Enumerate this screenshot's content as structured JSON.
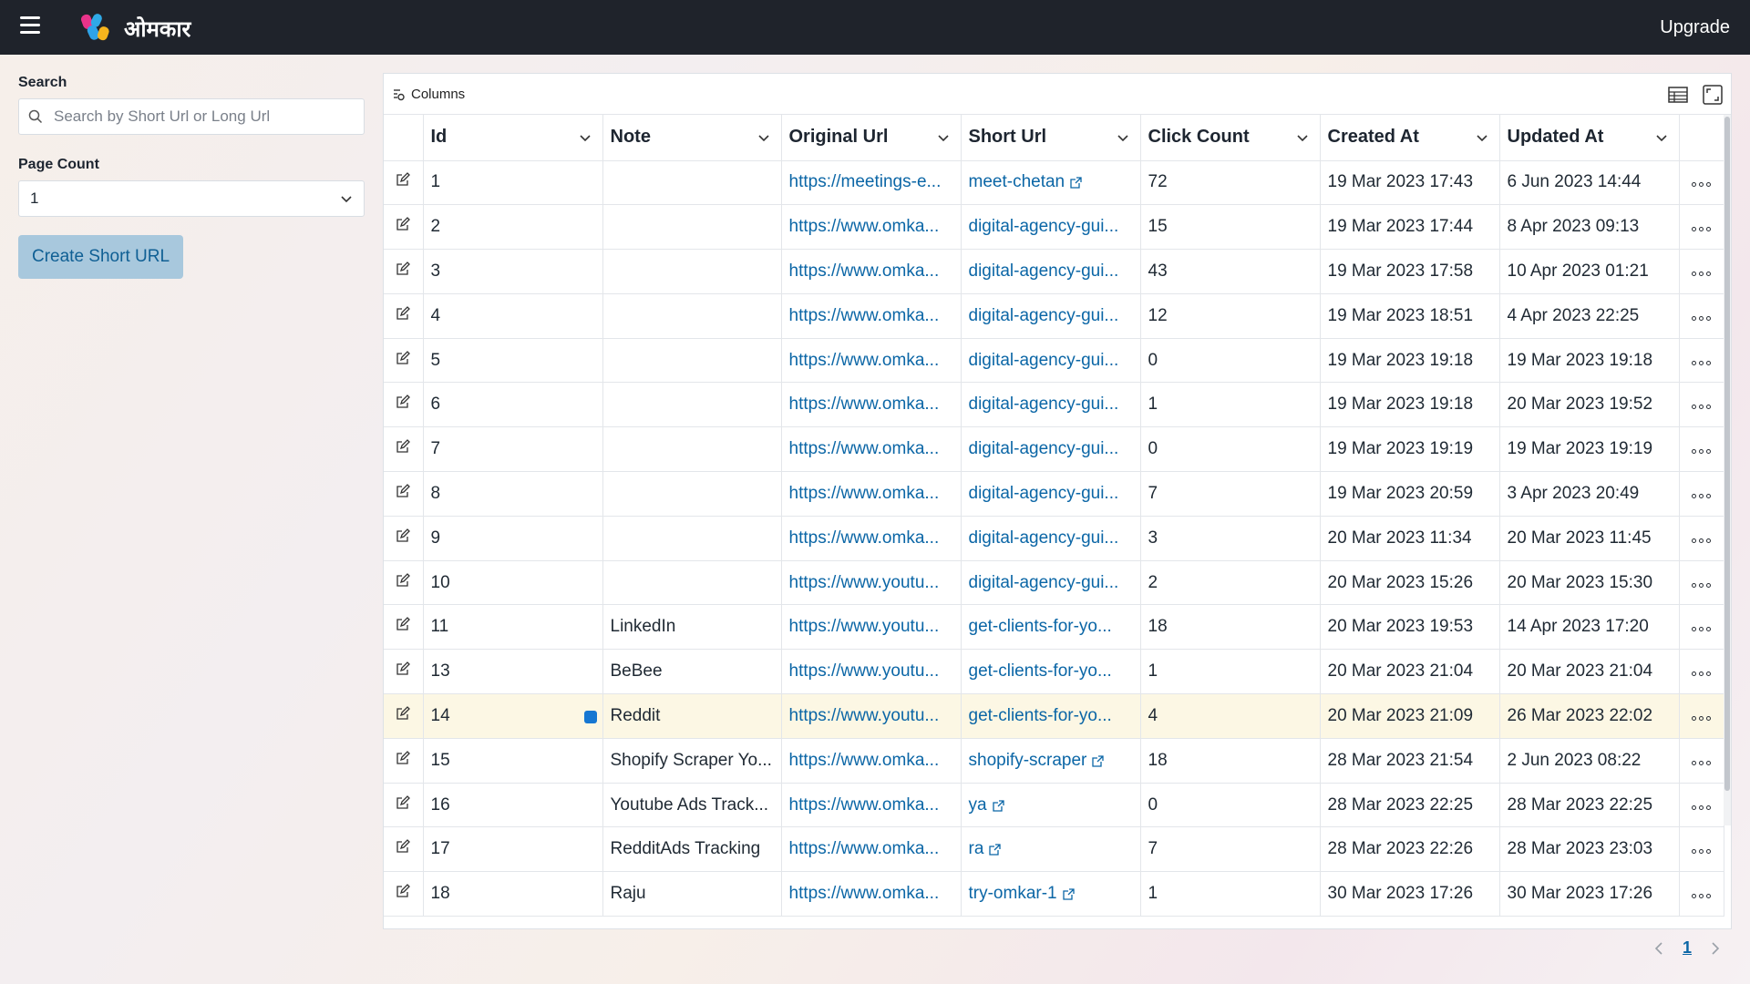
{
  "header": {
    "brand": "ओमकार",
    "upgrade_label": "Upgrade"
  },
  "sidebar": {
    "search_label": "Search",
    "search_placeholder": "Search by Short Url or Long Url",
    "page_count_label": "Page Count",
    "page_count_value": "1",
    "create_button": "Create Short URL"
  },
  "toolbar": {
    "columns_label": "Columns"
  },
  "table": {
    "headers": [
      "Id",
      "Note",
      "Original Url",
      "Short Url",
      "Click Count",
      "Created At",
      "Updated At"
    ],
    "rows": [
      {
        "id": "1",
        "note": "",
        "original": "https://meetings-e...",
        "short": "meet-chetan",
        "ext": true,
        "clicks": "72",
        "created": "19 Mar 2023 17:43",
        "updated": "6 Jun 2023 14:44"
      },
      {
        "id": "2",
        "note": "",
        "original": "https://www.omka...",
        "short": "digital-agency-gui...",
        "ext": false,
        "clicks": "15",
        "created": "19 Mar 2023 17:44",
        "updated": "8 Apr 2023 09:13"
      },
      {
        "id": "3",
        "note": "",
        "original": "https://www.omka...",
        "short": "digital-agency-gui...",
        "ext": false,
        "clicks": "43",
        "created": "19 Mar 2023 17:58",
        "updated": "10 Apr 2023 01:21"
      },
      {
        "id": "4",
        "note": "",
        "original": "https://www.omka...",
        "short": "digital-agency-gui...",
        "ext": false,
        "clicks": "12",
        "created": "19 Mar 2023 18:51",
        "updated": "4 Apr 2023 22:25"
      },
      {
        "id": "5",
        "note": "",
        "original": "https://www.omka...",
        "short": "digital-agency-gui...",
        "ext": false,
        "clicks": "0",
        "created": "19 Mar 2023 19:18",
        "updated": "19 Mar 2023 19:18"
      },
      {
        "id": "6",
        "note": "",
        "original": "https://www.omka...",
        "short": "digital-agency-gui...",
        "ext": false,
        "clicks": "1",
        "created": "19 Mar 2023 19:18",
        "updated": "20 Mar 2023 19:52"
      },
      {
        "id": "7",
        "note": "",
        "original": "https://www.omka...",
        "short": "digital-agency-gui...",
        "ext": false,
        "clicks": "0",
        "created": "19 Mar 2023 19:19",
        "updated": "19 Mar 2023 19:19"
      },
      {
        "id": "8",
        "note": "",
        "original": "https://www.omka...",
        "short": "digital-agency-gui...",
        "ext": false,
        "clicks": "7",
        "created": "19 Mar 2023 20:59",
        "updated": "3 Apr 2023 20:49"
      },
      {
        "id": "9",
        "note": "",
        "original": "https://www.omka...",
        "short": "digital-agency-gui...",
        "ext": false,
        "clicks": "3",
        "created": "20 Mar 2023 11:34",
        "updated": "20 Mar 2023 11:45"
      },
      {
        "id": "10",
        "note": "",
        "original": "https://www.youtu...",
        "short": "digital-agency-gui...",
        "ext": false,
        "clicks": "2",
        "created": "20 Mar 2023 15:26",
        "updated": "20 Mar 2023 15:30"
      },
      {
        "id": "11",
        "note": "LinkedIn",
        "original": "https://www.youtu...",
        "short": "get-clients-for-yo...",
        "ext": false,
        "clicks": "18",
        "created": "20 Mar 2023 19:53",
        "updated": "14 Apr 2023 17:20"
      },
      {
        "id": "13",
        "note": "BeBee",
        "original": "https://www.youtu...",
        "short": "get-clients-for-yo...",
        "ext": false,
        "clicks": "1",
        "created": "20 Mar 2023 21:04",
        "updated": "20 Mar 2023 21:04"
      },
      {
        "id": "14",
        "note": "Reddit",
        "original": "https://www.youtu...",
        "short": "get-clients-for-yo...",
        "ext": false,
        "clicks": "4",
        "created": "20 Mar 2023 21:09",
        "updated": "26 Mar 2023 22:02",
        "highlight": true
      },
      {
        "id": "15",
        "note": "Shopify Scraper Yo...",
        "original": "https://www.omka...",
        "short": "shopify-scraper",
        "ext": true,
        "clicks": "18",
        "created": "28 Mar 2023 21:54",
        "updated": "2 Jun 2023 08:22"
      },
      {
        "id": "16",
        "note": "Youtube Ads Track...",
        "original": "https://www.omka...",
        "short": "ya",
        "ext": true,
        "clicks": "0",
        "created": "28 Mar 2023 22:25",
        "updated": "28 Mar 2023 22:25"
      },
      {
        "id": "17",
        "note": "RedditAds Tracking",
        "original": "https://www.omka...",
        "short": "ra",
        "ext": true,
        "clicks": "7",
        "created": "28 Mar 2023 22:26",
        "updated": "28 Mar 2023 23:03"
      },
      {
        "id": "18",
        "note": "Raju",
        "original": "https://www.omka...",
        "short": "try-omkar-1",
        "ext": true,
        "clicks": "1",
        "created": "30 Mar 2023 17:26",
        "updated": "30 Mar 2023 17:26"
      }
    ]
  },
  "pagination": {
    "current": "1"
  },
  "colors": {
    "topbar": "#1f232b",
    "link": "#0b66a6",
    "button_bg": "#a8c8dd",
    "highlight_row": "#fcf7e4"
  }
}
